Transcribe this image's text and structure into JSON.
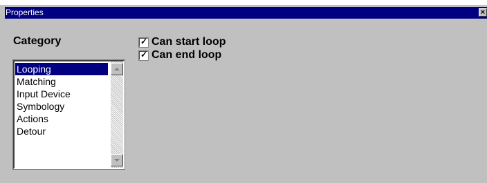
{
  "window": {
    "title": "Properties",
    "close_glyph": "✕"
  },
  "category": {
    "label": "Category",
    "items": [
      "Looping",
      "Matching",
      "Input Device",
      "Symbology",
      "Actions",
      "Detour"
    ],
    "selected": "Looping"
  },
  "options": {
    "can_start_loop": {
      "label": "Can start loop",
      "checked": true
    },
    "can_end_loop": {
      "label": "Can end loop",
      "checked": true
    }
  },
  "icons": {
    "close": "close-icon",
    "scroll_up": "scroll-up-arrow-icon",
    "scroll_down": "scroll-down-arrow-icon",
    "check": "checkmark-icon"
  },
  "colors": {
    "titlebar": "#000080",
    "face": "#c0c0c0",
    "selection": "#000080"
  }
}
